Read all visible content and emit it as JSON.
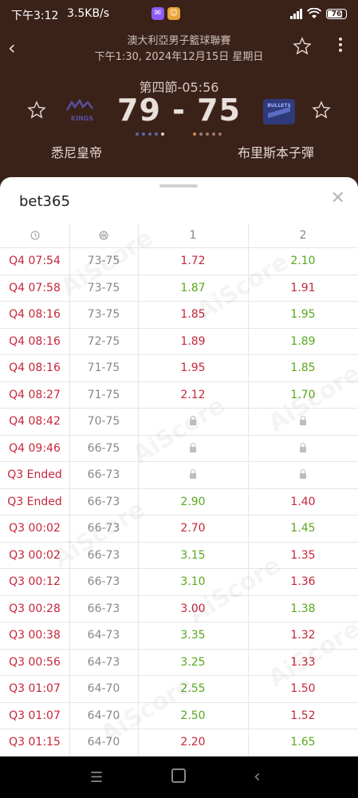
{
  "status_bar": {
    "time": "下午3:12",
    "network_speed": "3.5KB/s",
    "battery": "76"
  },
  "match": {
    "league": "澳大利亞男子籃球聯賽",
    "datetime": "下午1:30, 2024年12月15日 星期日",
    "period": "第四節-05:56",
    "score": "79 - 75",
    "home_team": "悉尼皇帝",
    "away_team": "布里斯本子彈",
    "home_logo_text": "KINGS",
    "away_logo_text": "BULLETS"
  },
  "odds_sheet": {
    "bookmaker": "bet365",
    "col_headers": {
      "odds1": "1",
      "odds2": "2"
    },
    "rows": [
      {
        "time": "Q4 07:54",
        "score": "73-75",
        "o1": "1.72",
        "o2": "2.10",
        "d1": "down",
        "d2": "up"
      },
      {
        "time": "Q4 07:58",
        "score": "73-75",
        "o1": "1.87",
        "o2": "1.91",
        "d1": "up",
        "d2": "down"
      },
      {
        "time": "Q4 08:16",
        "score": "73-75",
        "o1": "1.85",
        "o2": "1.95",
        "d1": "down",
        "d2": "up"
      },
      {
        "time": "Q4 08:16",
        "score": "72-75",
        "o1": "1.89",
        "o2": "1.89",
        "d1": "down",
        "d2": "up"
      },
      {
        "time": "Q4 08:16",
        "score": "71-75",
        "o1": "1.95",
        "o2": "1.85",
        "d1": "down",
        "d2": "up"
      },
      {
        "time": "Q4 08:27",
        "score": "71-75",
        "o1": "2.12",
        "o2": "1.70",
        "d1": "down",
        "d2": "up"
      },
      {
        "time": "Q4 08:42",
        "score": "70-75",
        "o1": "",
        "o2": "",
        "d1": "lock",
        "d2": "lock"
      },
      {
        "time": "Q4 09:46",
        "score": "66-75",
        "o1": "",
        "o2": "",
        "d1": "lock",
        "d2": "lock"
      },
      {
        "time": "Q3 Ended",
        "score": "66-73",
        "o1": "",
        "o2": "",
        "d1": "lock",
        "d2": "lock"
      },
      {
        "time": "Q3 Ended",
        "score": "66-73",
        "o1": "2.90",
        "o2": "1.40",
        "d1": "up",
        "d2": "down"
      },
      {
        "time": "Q3 00:02",
        "score": "66-73",
        "o1": "2.70",
        "o2": "1.45",
        "d1": "down",
        "d2": "up"
      },
      {
        "time": "Q3 00:02",
        "score": "66-73",
        "o1": "3.15",
        "o2": "1.35",
        "d1": "up",
        "d2": "down"
      },
      {
        "time": "Q3 00:12",
        "score": "66-73",
        "o1": "3.10",
        "o2": "1.36",
        "d1": "up",
        "d2": "down"
      },
      {
        "time": "Q3 00:28",
        "score": "66-73",
        "o1": "3.00",
        "o2": "1.38",
        "d1": "down",
        "d2": "up"
      },
      {
        "time": "Q3 00:38",
        "score": "64-73",
        "o1": "3.35",
        "o2": "1.32",
        "d1": "up",
        "d2": "down"
      },
      {
        "time": "Q3 00:56",
        "score": "64-73",
        "o1": "3.25",
        "o2": "1.33",
        "d1": "up",
        "d2": "down"
      },
      {
        "time": "Q3 01:07",
        "score": "64-70",
        "o1": "2.55",
        "o2": "1.50",
        "d1": "up",
        "d2": "down"
      },
      {
        "time": "Q3 01:07",
        "score": "64-70",
        "o1": "2.50",
        "o2": "1.52",
        "d1": "up",
        "d2": "down"
      },
      {
        "time": "Q3 01:15",
        "score": "64-70",
        "o1": "2.20",
        "o2": "1.65",
        "d1": "down",
        "d2": "up"
      }
    ]
  },
  "watermark": "AiScore",
  "colors": {
    "header_bg": "#3a2219",
    "up": "#59a81c",
    "down": "#c5273a"
  }
}
